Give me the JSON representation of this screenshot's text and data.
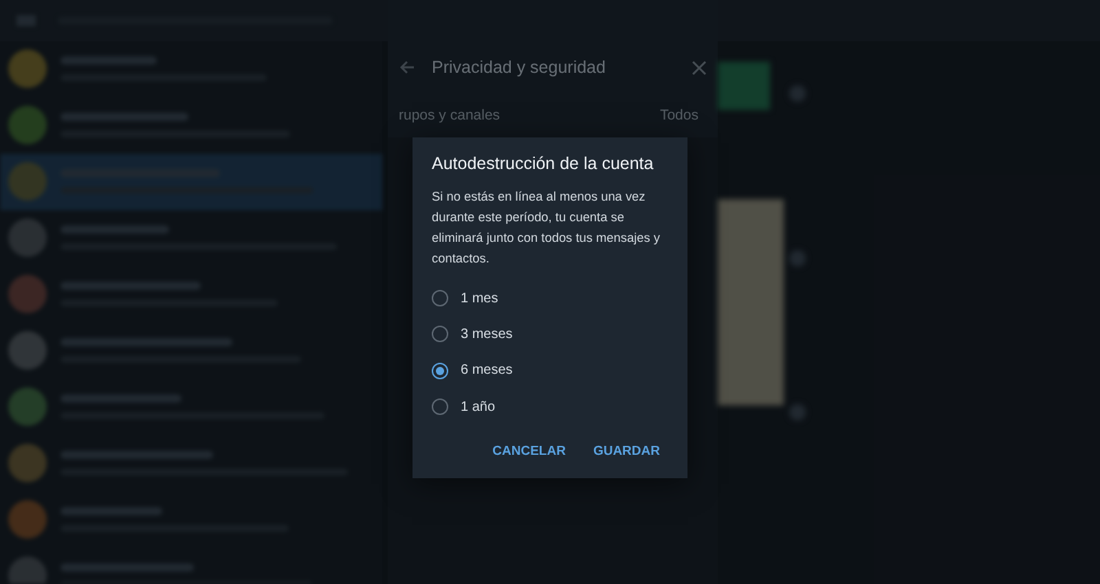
{
  "settings_panel": {
    "title": "Privacidad y seguridad",
    "rows": [
      {
        "label": "rupos y canales",
        "value": "Todos"
      }
    ]
  },
  "dialog": {
    "title": "Autodestrucción de la cuenta",
    "message": "Si no estás en línea al menos una vez durante este período, tu cuenta se eliminará junto con todos tus mensajes y contactos.",
    "options": [
      {
        "label": "1 mes",
        "selected": false
      },
      {
        "label": "3 meses",
        "selected": false
      },
      {
        "label": "6 meses",
        "selected": true
      },
      {
        "label": "1 año",
        "selected": false
      }
    ],
    "buttons": [
      "CANCELAR",
      "GUARDAR"
    ]
  }
}
